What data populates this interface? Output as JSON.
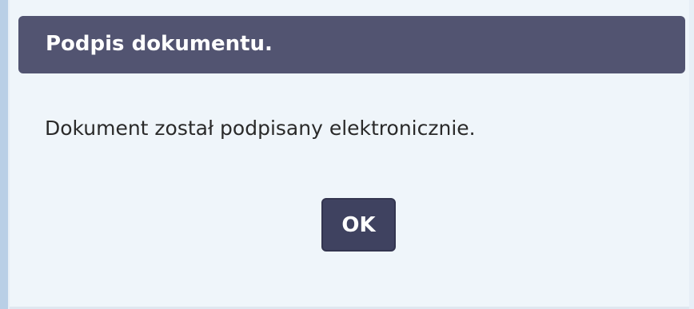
{
  "dialog": {
    "title": "Podpis dokumentu.",
    "message": "Dokument został podpisany elektronicznie.",
    "ok_label": "OK"
  },
  "colors": {
    "header_bg": "#525471",
    "button_bg": "#3f4260",
    "dialog_bg": "#eff5fa",
    "text": "#2a2a2a"
  }
}
